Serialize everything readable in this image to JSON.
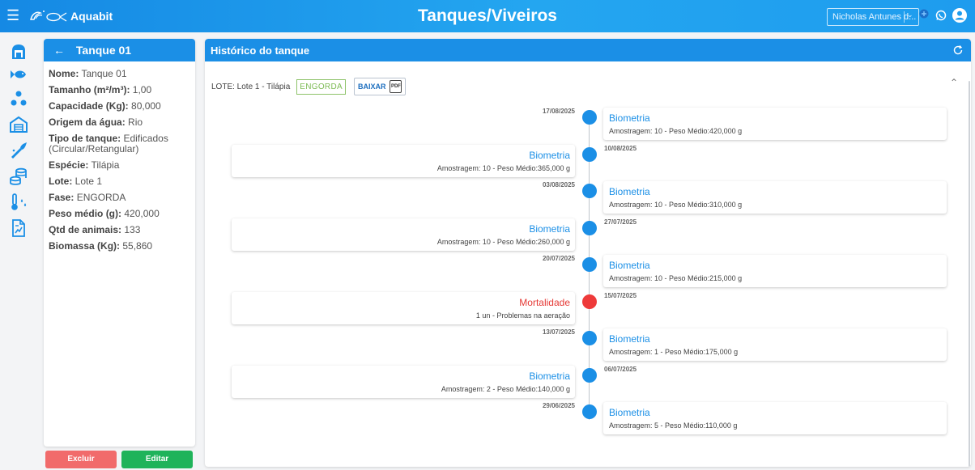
{
  "app": {
    "menu_icon": "menu-icon",
    "logo": "aquabit-logo",
    "brand": "Aquabit",
    "page_title": "Tanques/Viveiros",
    "user_name": "Nicholas Antunes d...",
    "user_chevron": "⌄",
    "icons": [
      "add-circle-icon",
      "whatsapp-icon",
      "account-icon"
    ]
  },
  "sidenav": {
    "icons": [
      "dashboard-icon",
      "fish-icon",
      "groups-icon",
      "warehouse-icon",
      "feed-icon",
      "stock-icon",
      "water-quality-icon",
      "report-icon"
    ]
  },
  "tank_panel": {
    "back_icon": "←",
    "title": "Tanque 01",
    "fields": [
      {
        "label": "Nome:",
        "value": "Tanque 01"
      },
      {
        "label": "Tamanho (m²/m³):",
        "value": "1,00"
      },
      {
        "label": "Capacidade (Kg):",
        "value": "80,000"
      },
      {
        "label": "Origem da água:",
        "value": "Rio"
      },
      {
        "label": "Tipo de tanque:",
        "value": "Edificados (Circular/Retangular)"
      },
      {
        "label": "Espécie:",
        "value": "Tilápia"
      },
      {
        "label": "Lote:",
        "value": "Lote 1"
      },
      {
        "label": "Fase:",
        "value": "ENGORDA"
      },
      {
        "label": "Peso médio (g):",
        "value": "420,000"
      },
      {
        "label": "Qtd de animais:",
        "value": "133"
      },
      {
        "label": "Biomassa (Kg):",
        "value": "55,860"
      }
    ],
    "delete_label": "Excluir",
    "edit_label": "Editar"
  },
  "history": {
    "title": "Histórico do tanque",
    "refresh_icon": "refresh-icon",
    "lote_label": "LOTE: Lote 1 - Tilápia",
    "phase_badge": "ENGORDA",
    "download_label": "BAIXAR",
    "pdf_label": "PDF",
    "collapse_icon": "⌃",
    "colors": {
      "accent": "#1b8fe6",
      "danger": "#ee3a3a"
    },
    "events": [
      {
        "date": "17/08/2025",
        "title": "Biometria",
        "desc": "Amostragem: 10 - Peso Médio:420,000 g",
        "side": "right",
        "kind": "biometria"
      },
      {
        "date": "10/08/2025",
        "title": "Biometria",
        "desc": "Amostragem: 10 - Peso Médio:365,000 g",
        "side": "left",
        "kind": "biometria"
      },
      {
        "date": "03/08/2025",
        "title": "Biometria",
        "desc": "Amostragem: 10 - Peso Médio:310,000 g",
        "side": "right",
        "kind": "biometria"
      },
      {
        "date": "27/07/2025",
        "title": "Biometria",
        "desc": "Amostragem: 10 - Peso Médio:260,000 g",
        "side": "left",
        "kind": "biometria"
      },
      {
        "date": "20/07/2025",
        "title": "Biometria",
        "desc": "Amostragem: 10 - Peso Médio:215,000 g",
        "side": "right",
        "kind": "biometria"
      },
      {
        "date": "15/07/2025",
        "title": "Mortalidade",
        "desc": "1 un - Problemas na aeração",
        "side": "left",
        "kind": "mortalidade"
      },
      {
        "date": "13/07/2025",
        "title": "Biometria",
        "desc": "Amostragem: 1 - Peso Médio:175,000 g",
        "side": "right",
        "kind": "biometria"
      },
      {
        "date": "06/07/2025",
        "title": "Biometria",
        "desc": "Amostragem: 2 - Peso Médio:140,000 g",
        "side": "left",
        "kind": "biometria"
      },
      {
        "date": "29/06/2025",
        "title": "Biometria",
        "desc": "Amostragem: 5 - Peso Médio:110,000 g",
        "side": "right",
        "kind": "biometria"
      }
    ]
  }
}
